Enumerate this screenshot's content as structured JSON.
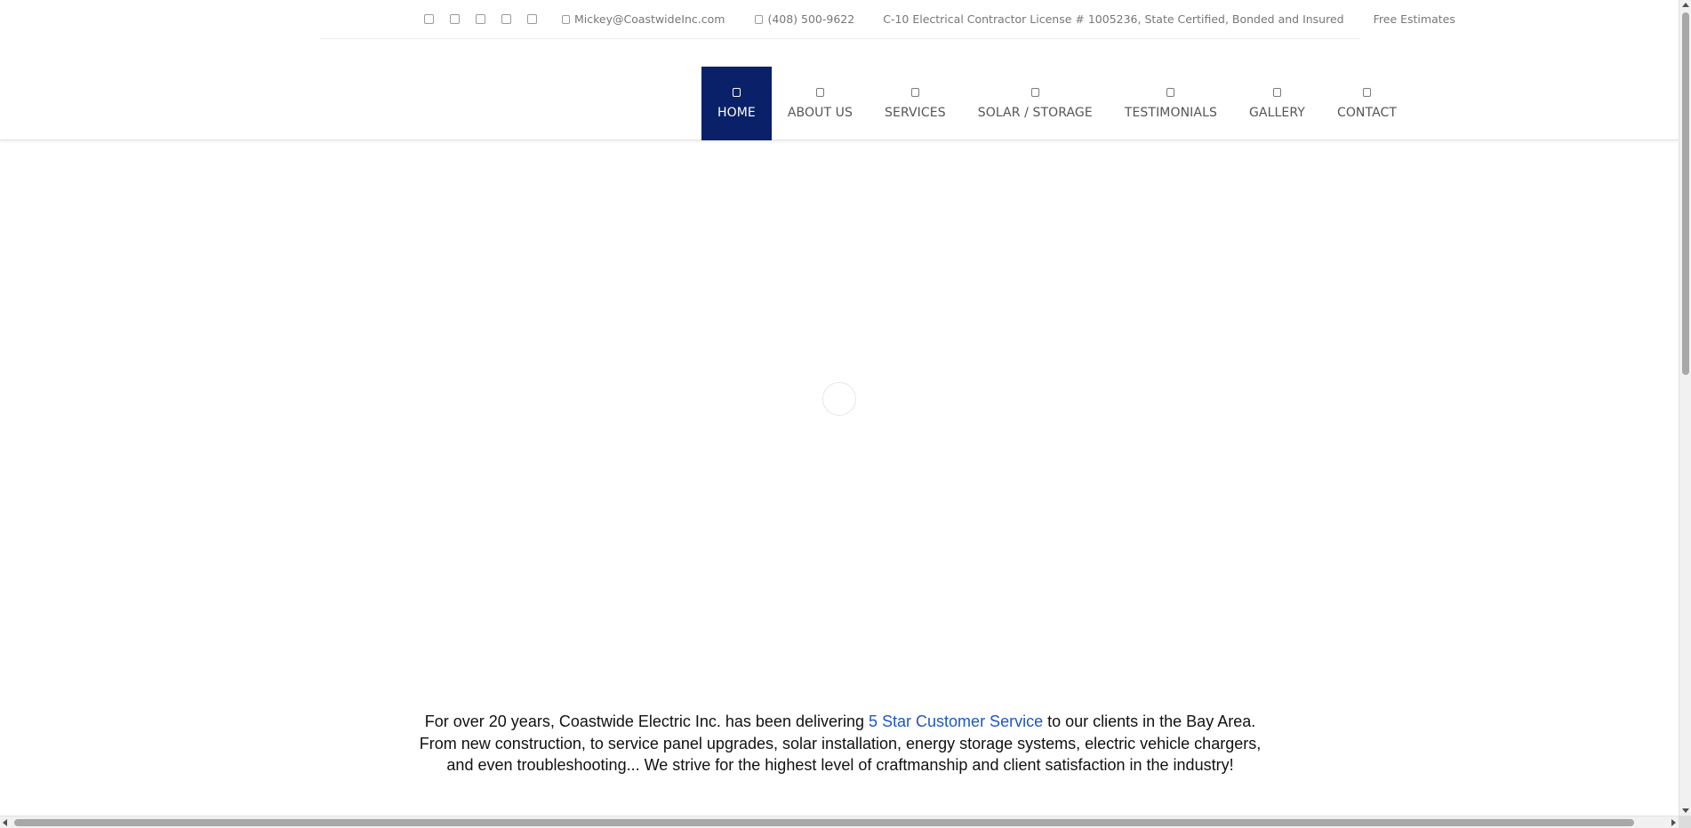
{
  "topbar": {
    "social_icons": [
      "facebook-icon",
      "twitter-icon",
      "instagram-icon",
      "linkedin-icon",
      "yelp-icon"
    ],
    "email": "Mickey@CoastwideInc.com",
    "phone": "(408) 500-9622",
    "license": "C-10 Electrical Contractor License # 1005236, State Certified, Bonded and Insured",
    "estimates": "Free Estimates"
  },
  "nav": {
    "items": [
      {
        "label": "HOME",
        "active": true
      },
      {
        "label": "ABOUT US"
      },
      {
        "label": "SERVICES"
      },
      {
        "label": "SOLAR / STORAGE"
      },
      {
        "label": "TESTIMONIALS"
      },
      {
        "label": "GALLERY"
      },
      {
        "label": "CONTACT"
      }
    ]
  },
  "intro": {
    "line1_before": "For over 20 years, Coastwide Electric Inc. has been delivering ",
    "link": "5 Star Customer Service",
    "line1_after": " to our clients in the Bay Area.",
    "line2": "From new construction, to service panel upgrades, solar installation, energy storage systems, electric vehicle chargers,",
    "line3": "and even troubleshooting... We strive for the highest level of craftmanship and client satisfaction in the industry!"
  },
  "colors": {
    "nav_active_bg": "#0a2169",
    "link": "#1e56c8"
  }
}
